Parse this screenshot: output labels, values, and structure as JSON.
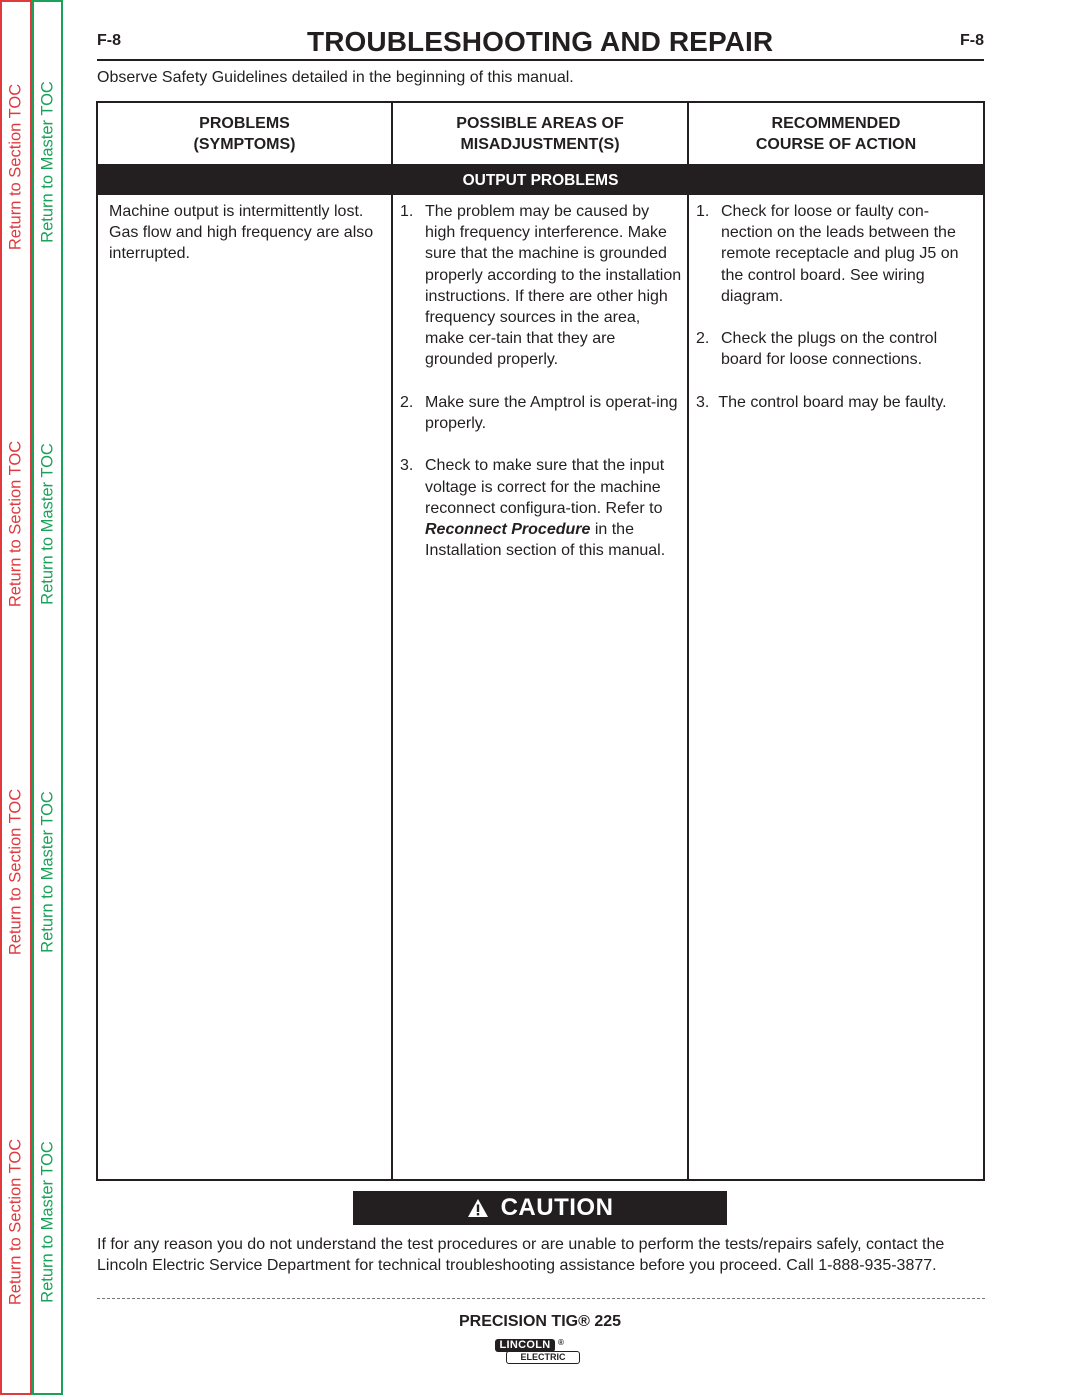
{
  "sidebar": {
    "section_toc_label": "Return to Section TOC",
    "master_toc_label": "Return to Master TOC",
    "colors": {
      "section": "#e03a3e",
      "master": "#1aa25b"
    }
  },
  "header": {
    "page_number_left": "F-8",
    "page_number_right": "F-8",
    "title": "TROUBLESHOOTING AND REPAIR",
    "safety_note": "Observe Safety Guidelines detailed in the beginning of this manual."
  },
  "table": {
    "columns": [
      {
        "line1": "PROBLEMS",
        "line2": "(SYMPTOMS)"
      },
      {
        "line1": "POSSIBLE AREAS OF",
        "line2": "MISADJUSTMENT(S)"
      },
      {
        "line1": "RECOMMENDED",
        "line2": "COURSE OF ACTION"
      }
    ],
    "section_title": "OUTPUT PROBLEMS",
    "rows": [
      {
        "symptom": "Machine output is intermittently lost.  Gas flow and high frequency are also interrupted.",
        "misadjustments": [
          {
            "num": "1.",
            "text": "The problem may be caused by high frequency interference. Make sure that the machine is grounded  properly according to the installation instructions.   If there are other high frequency sources in the area, make cer-tain that they are grounded properly."
          },
          {
            "num": "2.",
            "text": "Make sure the Amptrol is operat-ing properly."
          },
          {
            "num": "3.",
            "text_before": "Check to make sure that the input voltage is correct for the machine reconnect configura-tion. Refer to ",
            "emphasis": "Reconnect Procedure",
            "text_after": " in the Installation section of this manual."
          }
        ],
        "actions": [
          {
            "num": "1.",
            "text": "Check for loose or faulty con-nection on the leads between the remote receptacle and plug J5 on the control board.  See wiring diagram."
          },
          {
            "num": "2.",
            "text": "Check the plugs on the control board for loose connections."
          },
          {
            "num": "3.",
            "text": "The control board may be faulty."
          }
        ]
      }
    ]
  },
  "caution": {
    "icon": "warning-triangle-icon",
    "label": "CAUTION",
    "text": "If for any reason you do not understand the test procedures or are unable to perform the tests/repairs safely, contact the Lincoln Electric Service Department for technical troubleshooting assistance before you proceed. Call 1-888-935-3877."
  },
  "footer": {
    "product_name": "PRECISION TIG® 225",
    "logo_top": "LINCOLN",
    "logo_registered": "®",
    "logo_bottom": "ELECTRIC"
  }
}
